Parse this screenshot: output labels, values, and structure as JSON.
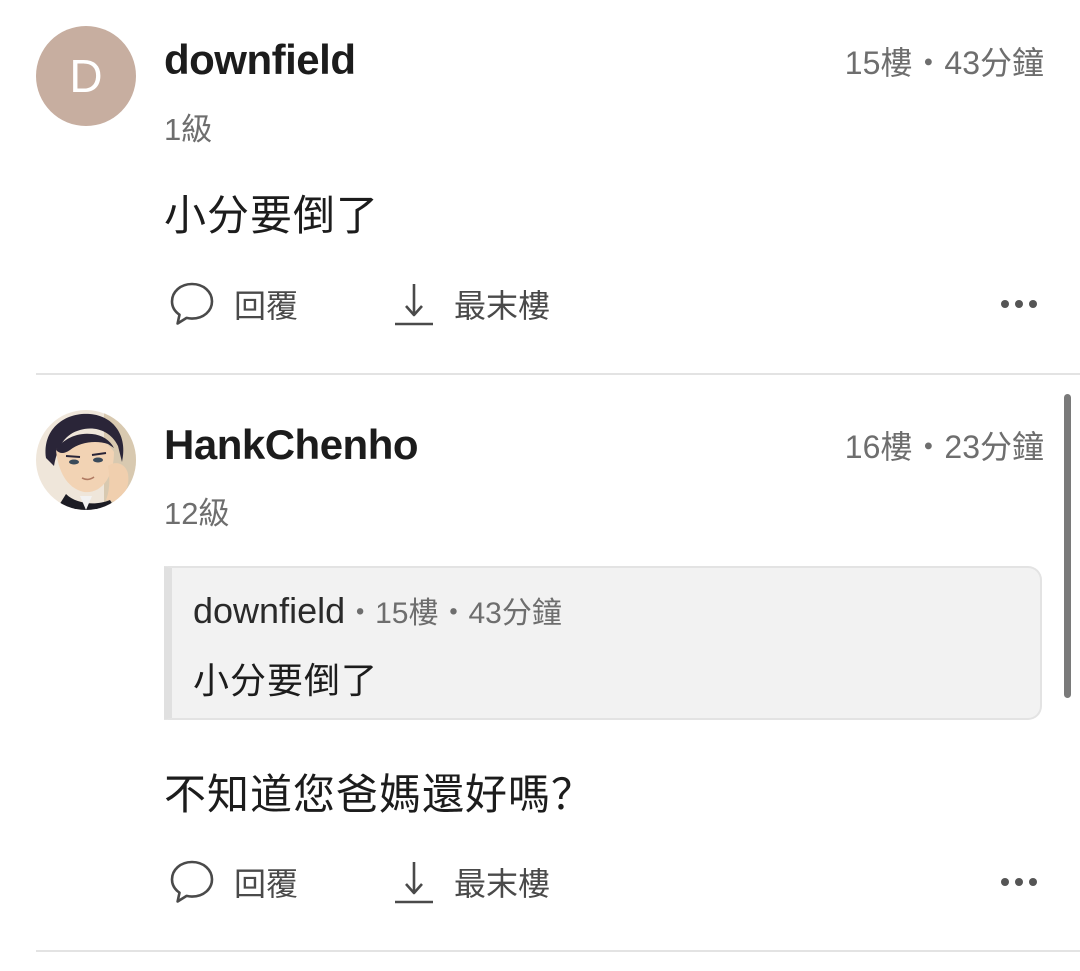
{
  "comments": [
    {
      "avatar": {
        "type": "letter",
        "letter": "D",
        "color": "#c7aea0"
      },
      "username": "downfield",
      "meta": "15樓・43分鐘",
      "level": "1級",
      "body": "小分要倒了",
      "actions": {
        "reply": "回覆",
        "jump": "最末樓",
        "more_icon": "more-dots-icon"
      }
    },
    {
      "avatar": {
        "type": "image",
        "description": "anime-character-portrait"
      },
      "username": "HankChenho",
      "meta": "16樓・23分鐘",
      "level": "12級",
      "quote": {
        "username": "downfield",
        "meta": "・15樓・43分鐘",
        "text": "小分要倒了"
      },
      "body": "不知道您爸媽還好嗎？",
      "actions": {
        "reply": "回覆",
        "jump": "最末樓",
        "more_icon": "more-dots-icon"
      }
    }
  ],
  "colors": {
    "text": "#1c1c1c",
    "secondary": "#6e6e6e",
    "divider": "#e3e3e3",
    "quote_bg": "#f2f2f2"
  }
}
